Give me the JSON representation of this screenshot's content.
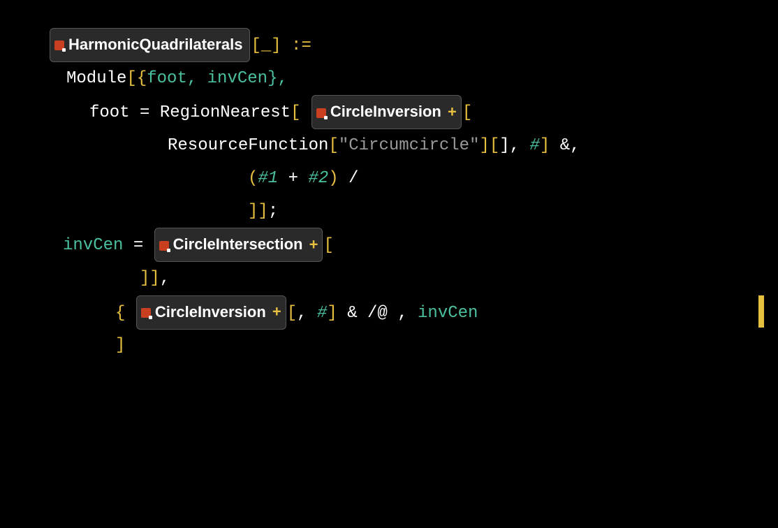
{
  "resources": {
    "harmonicQuadrilaterals": "HarmonicQuadrilaterals",
    "circleInversion": "CircleInversion",
    "circleIntersection": "CircleIntersection"
  },
  "tokens": {
    "module": "Module",
    "foot": "foot",
    "invCen": "invCen",
    "regionNearest": "RegionNearest",
    "resourceFunction": "ResourceFunction",
    "circumcircle": "\"Circumcircle\"",
    "slotHash": "#",
    "slot1": "#1",
    "slot2": "#2",
    "assign": ":=",
    "set": "=",
    "lbrace": "{",
    "rbrace": "}",
    "lbrack": "[",
    "rbrack": "]",
    "lparen": "(",
    "rparen": ")",
    "comma": ",",
    "semicolon": ";",
    "amp": "&",
    "slash": "/",
    "at": "@"
  },
  "trailing": {
    "line1": "[_] :=",
    "line2": ", invCen},",
    "line3": "[",
    "line4_a": "ResourceFunction",
    "line4_c": ", ",
    "line4_d": "#",
    "line4_e": "] &,",
    "line5_a": "(",
    "line5_b": "#1",
    "line5_c": " + ",
    "line5_d": "#2",
    "line5_e": ")",
    "line5_f": " / ",
    "line6": ";",
    "line7": "[",
    "line8": ", ",
    "line9_a": "#",
    "line9_b": " & /@ ",
    "line9_c": ", ",
    "line9_d": "invCen"
  }
}
